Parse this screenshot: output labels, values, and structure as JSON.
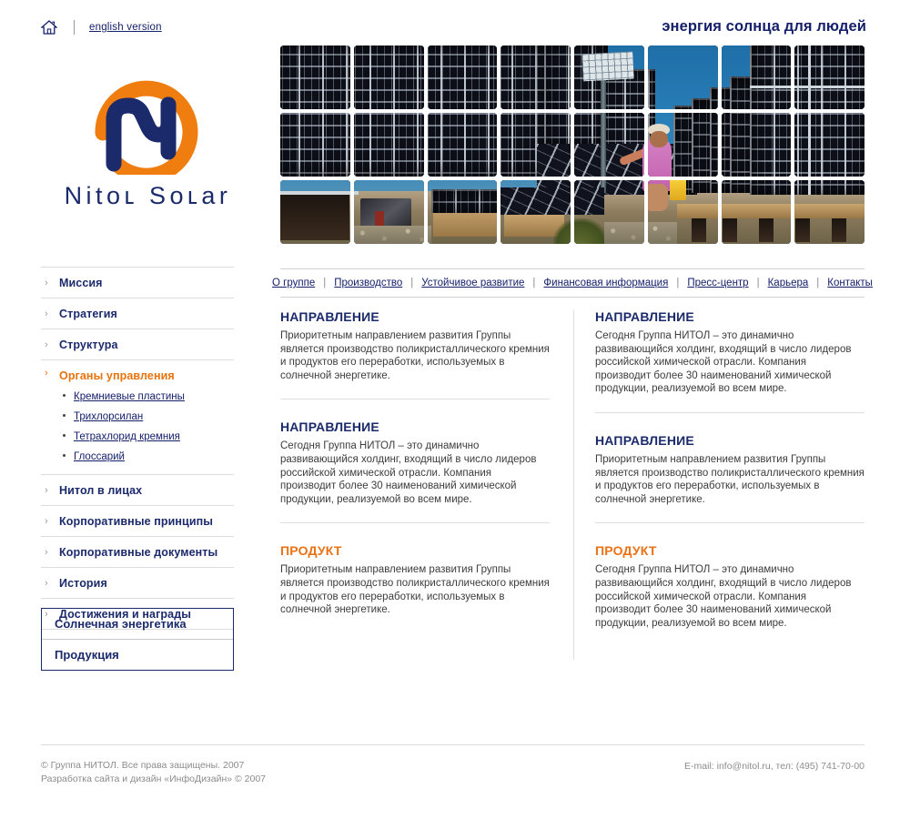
{
  "topbar": {
    "home_icon": "home-icon",
    "english_link": "english version",
    "tagline": "энергия солнца для людей"
  },
  "logo": {
    "text": "Nitoʟ Soʟar",
    "arc_color": "#f07d10",
    "mark_color": "#1b2a6b"
  },
  "banner": {
    "alt": "solar panel field collage"
  },
  "mainnav": {
    "separator": "|",
    "items": [
      {
        "label": "О группе"
      },
      {
        "label": "Производство"
      },
      {
        "label": "Устойчивое развитие"
      },
      {
        "label": "Финансовая информация"
      },
      {
        "label": "Пресс-центр"
      },
      {
        "label": "Карьера"
      },
      {
        "label": "Контакты"
      }
    ]
  },
  "sidebar": {
    "chevron": "›",
    "items": [
      {
        "label": "Миссия"
      },
      {
        "label": "Стратегия"
      },
      {
        "label": "Структура"
      },
      {
        "label": "Органы управления",
        "active": true
      },
      {
        "label": "Нитол в лицах"
      },
      {
        "label": "Корпоративные принципы"
      },
      {
        "label": "Корпоративные документы"
      },
      {
        "label": "История"
      },
      {
        "label": "Достижения и награды"
      }
    ],
    "subitems": [
      {
        "label": "Кремниевые пластины"
      },
      {
        "label": "Трихлорсилан"
      },
      {
        "label": "Тетрахлорид кремния"
      },
      {
        "label": "Глоссарий"
      }
    ],
    "promo": [
      {
        "label": "Солнечная энергетика"
      },
      {
        "label": "Продукция"
      }
    ]
  },
  "content": {
    "text_a": "Приоритетным направлением развития Группы является производство поликристаллического кремния и продуктов его переработки, используемых в солнечной энергетике.",
    "text_b": "Сегодня Группа НИТОЛ – это динамично развивающийся холдинг, входящий в число лидеров российской химической отрасли. Компания производит более 30 наименований химической продукции, реализуемой во всем мире.",
    "left_column": [
      {
        "heading": "НАПРАВЛЕНИЕ",
        "color": "navy",
        "body": "Приоритетным направлением развития Группы является производство поликристаллического кремния и продуктов его переработки, используемых в солнечной энергетике."
      },
      {
        "heading": "НАПРАВЛЕНИЕ",
        "color": "navy",
        "body": "Сегодня Группа НИТОЛ – это динамично развивающийся холдинг, входящий в число лидеров российской химической отрасли. Компания производит более 30 наименований химической продукции, реализуемой во всем мире."
      },
      {
        "heading": "ПРОДУКТ",
        "color": "orange",
        "body": "Приоритетным направлением развития Группы является производство поликристаллического кремния и продуктов его переработки, используемых в солнечной энергетике."
      }
    ],
    "right_column": [
      {
        "heading": "НАПРАВЛЕНИЕ",
        "color": "navy",
        "body": "Сегодня Группа НИТОЛ – это динамично развивающийся холдинг, входящий в число лидеров российской химической отрасли. Компания производит более 30 наименований химической продукции, реализуемой во всем мире."
      },
      {
        "heading": "НАПРАВЛЕНИЕ",
        "color": "navy",
        "body": "Приоритетным направлением развития Группы является производство поликристаллического кремния и продуктов его переработки, используемых в солнечной энергетике."
      },
      {
        "heading": "ПРОДУКТ",
        "color": "orange",
        "body": "Сегодня Группа НИТОЛ – это динамично развивающийся холдинг, входящий в число лидеров российской химической отрасли. Компания производит более 30 наименований химической продукции, реализуемой во всем мире."
      }
    ]
  },
  "footer": {
    "copyright_line1": "© Группа НИТОЛ. Все права защищены. 2007",
    "copyright_line2": "Разработка сайта и дизайн «ИнфоДизайн» © 2007",
    "contacts": "E-mail: info@nitol.ru, тел: (495) 741-70-00"
  },
  "colors": {
    "navy": "#1b2a6b",
    "orange": "#ea7214",
    "link": "#15206b",
    "muted": "#8c8c8c"
  }
}
